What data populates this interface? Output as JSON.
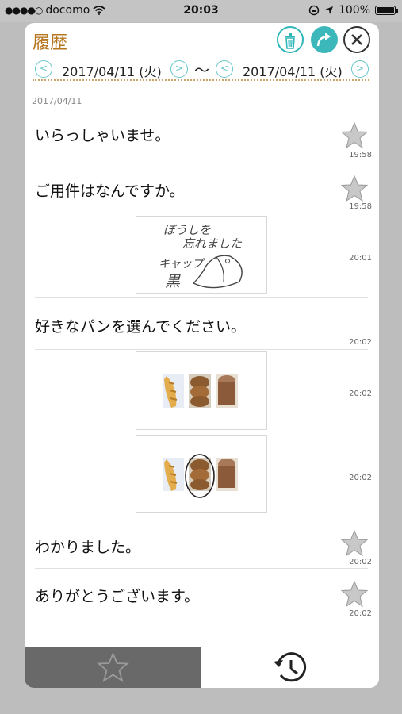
{
  "status_bar": {
    "carrier": "docomo",
    "time": "20:03",
    "battery": "100%"
  },
  "header": {
    "title": "履歴"
  },
  "date_range": {
    "start": "2017/04/11 (火)",
    "separator": "〜",
    "end": "2017/04/11 (火)",
    "prev_symbol": "<",
    "next_symbol": ">"
  },
  "history": {
    "date_label": "2017/04/11",
    "items": [
      {
        "type": "text",
        "text": "いらっしゃいませ。",
        "time": "19:58",
        "starred": false
      },
      {
        "type": "text",
        "text": "ご用件はなんですか。",
        "time": "19:58",
        "starred": false
      },
      {
        "type": "drawing",
        "handwriting": [
          "ぼうしを",
          "忘れました",
          "キャップ",
          "黒"
        ],
        "time": "20:01"
      },
      {
        "type": "text",
        "text": "好きなパンを選んでください。",
        "time": "20:02"
      },
      {
        "type": "image",
        "content": "three bread photos",
        "time": "20:02"
      },
      {
        "type": "image",
        "content": "three bread photos, middle circled",
        "time": "20:02"
      },
      {
        "type": "text",
        "text": "わかりました。",
        "time": "20:02",
        "starred": false
      },
      {
        "type": "text",
        "text": "ありがとうございます。",
        "time": "20:02",
        "starred": false
      }
    ]
  },
  "tabs": {
    "favorites_icon": "star-icon",
    "history_icon": "history-clock-icon",
    "active": "history"
  },
  "colors": {
    "title": "#b6761f",
    "accent_teal": "#3cb8bb",
    "tab_dark": "#696969"
  }
}
